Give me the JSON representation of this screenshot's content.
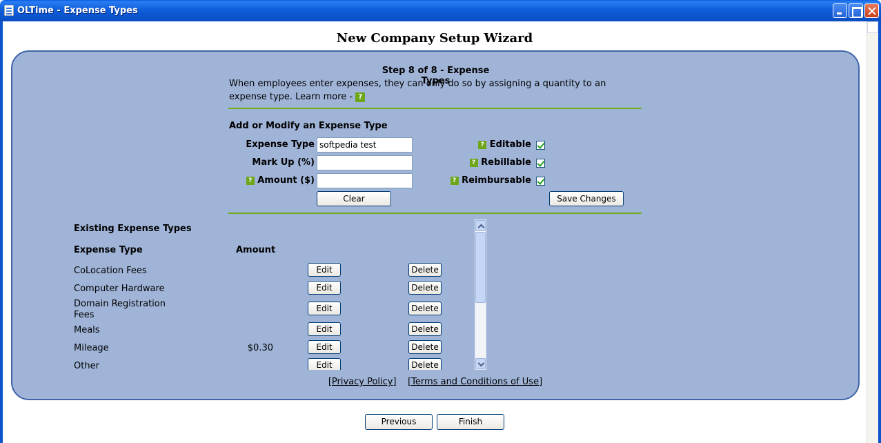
{
  "window": {
    "title": "OLTime - Expense Types"
  },
  "wizard": {
    "title": "New Company Setup Wizard",
    "step_title": "Step 8 of 8 - Expense Types",
    "description": "When employees enter expenses, they can only do so by assigning a quantity to an expense type.  Learn more - ",
    "help_glyph": "?"
  },
  "form": {
    "section_title": "Add or Modify an Expense Type",
    "expense_type_label": "Expense Type",
    "expense_type_value": "softpedia test",
    "markup_label": "Mark Up (%)",
    "markup_value": "",
    "amount_label": "Amount ($)",
    "amount_value": "",
    "editable_label": "Editable",
    "editable_checked": true,
    "rebillable_label": "Rebillable",
    "rebillable_checked": true,
    "reimbursable_label": "Reimbursable",
    "reimbursable_checked": true,
    "clear_label": "Clear",
    "save_label": "Save Changes"
  },
  "existing": {
    "title": "Existing Expense Types",
    "col_type": "Expense Type",
    "col_amount": "Amount",
    "edit_label": "Edit",
    "delete_label": "Delete",
    "rows": [
      {
        "name": "CoLocation Fees",
        "amount": ""
      },
      {
        "name": "Computer Hardware",
        "amount": ""
      },
      {
        "name": "Domain Registration Fees",
        "amount": ""
      },
      {
        "name": "Meals",
        "amount": ""
      },
      {
        "name": "Mileage",
        "amount": "$0.30"
      },
      {
        "name": "Other",
        "amount": ""
      }
    ]
  },
  "footer": {
    "privacy_link": "[Privacy Policy]",
    "terms_link": "[Terms and Conditions of Use]"
  },
  "nav": {
    "previous_label": "Previous",
    "finish_label": "Finish"
  }
}
